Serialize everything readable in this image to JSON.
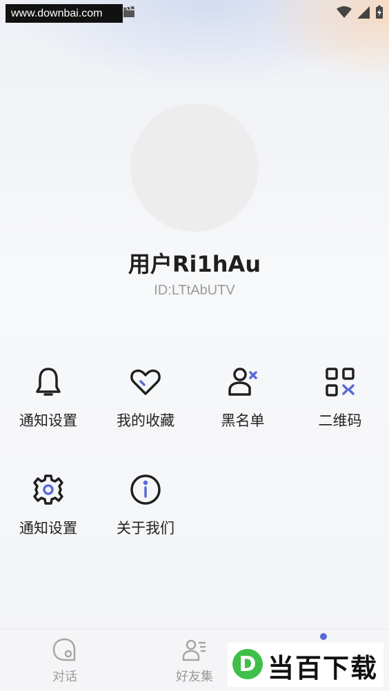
{
  "watermark": "www.downbai.com",
  "status_bar": {
    "icons": [
      "clapperboard-icon",
      "wifi-icon",
      "signal-icon",
      "battery-charging-icon"
    ]
  },
  "profile": {
    "username": "用户Ri1hAu",
    "user_id": "ID:LTtAbUTV"
  },
  "menu": {
    "items": [
      {
        "label": "通知设置",
        "icon": "bell-icon"
      },
      {
        "label": "我的收藏",
        "icon": "heart-icon"
      },
      {
        "label": "黑名单",
        "icon": "user-block-icon"
      },
      {
        "label": "二维码",
        "icon": "qr-code-icon"
      },
      {
        "label": "通知设置",
        "icon": "gear-icon"
      },
      {
        "label": "关于我们",
        "icon": "info-icon"
      }
    ]
  },
  "bottom_nav": {
    "items": [
      {
        "label": "对话",
        "icon": "chat-icon"
      },
      {
        "label": "好友集",
        "icon": "contacts-icon"
      }
    ]
  },
  "brand": {
    "text": "当百下载",
    "logo_letter": "D"
  },
  "colors": {
    "accent": "#5b6ad8",
    "text": "#222222",
    "muted": "#9a9a9a",
    "avatar": "#ededed"
  }
}
